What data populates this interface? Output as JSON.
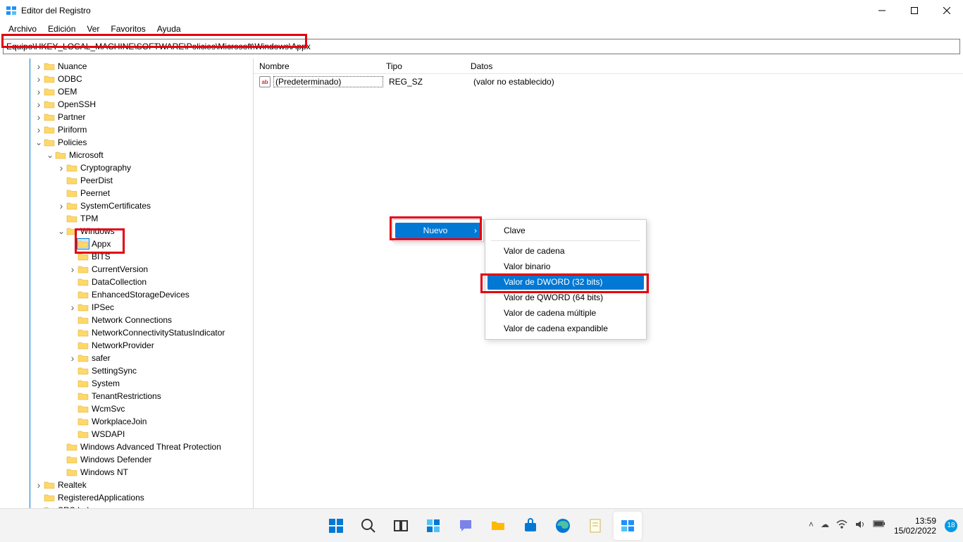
{
  "window": {
    "title": "Editor del Registro"
  },
  "menus": [
    "Archivo",
    "Edición",
    "Ver",
    "Favoritos",
    "Ayuda"
  ],
  "address": "Equipo\\HKEY_LOCAL_MACHINE\\SOFTWARE\\Policies\\Microsoft\\Windows\\Appx",
  "tree": {
    "top": [
      {
        "d": 3,
        "e": "closed",
        "l": "Nuance"
      },
      {
        "d": 3,
        "e": "closed",
        "l": "ODBC"
      },
      {
        "d": 3,
        "e": "closed",
        "l": "OEM"
      },
      {
        "d": 3,
        "e": "closed",
        "l": "OpenSSH"
      },
      {
        "d": 3,
        "e": "closed",
        "l": "Partner"
      },
      {
        "d": 3,
        "e": "closed",
        "l": "Piriform"
      },
      {
        "d": 3,
        "e": "open",
        "l": "Policies"
      },
      {
        "d": 4,
        "e": "open",
        "l": "Microsoft"
      },
      {
        "d": 5,
        "e": "closed",
        "l": "Cryptography"
      },
      {
        "d": 5,
        "e": "none",
        "l": "PeerDist"
      },
      {
        "d": 5,
        "e": "none",
        "l": "Peernet"
      },
      {
        "d": 5,
        "e": "closed",
        "l": "SystemCertificates"
      },
      {
        "d": 5,
        "e": "none",
        "l": "TPM"
      },
      {
        "d": 5,
        "e": "open",
        "l": "Windows"
      },
      {
        "d": 6,
        "e": "none",
        "l": "Appx",
        "sel": true
      },
      {
        "d": 6,
        "e": "none",
        "l": "BITS"
      },
      {
        "d": 6,
        "e": "closed",
        "l": "CurrentVersion"
      },
      {
        "d": 6,
        "e": "none",
        "l": "DataCollection"
      },
      {
        "d": 6,
        "e": "none",
        "l": "EnhancedStorageDevices"
      },
      {
        "d": 6,
        "e": "closed",
        "l": "IPSec"
      },
      {
        "d": 6,
        "e": "none",
        "l": "Network Connections"
      },
      {
        "d": 6,
        "e": "none",
        "l": "NetworkConnectivityStatusIndicator"
      },
      {
        "d": 6,
        "e": "none",
        "l": "NetworkProvider"
      },
      {
        "d": 6,
        "e": "closed",
        "l": "safer"
      },
      {
        "d": 6,
        "e": "none",
        "l": "SettingSync"
      },
      {
        "d": 6,
        "e": "none",
        "l": "System"
      },
      {
        "d": 6,
        "e": "none",
        "l": "TenantRestrictions"
      },
      {
        "d": 6,
        "e": "none",
        "l": "WcmSvc"
      },
      {
        "d": 6,
        "e": "none",
        "l": "WorkplaceJoin"
      },
      {
        "d": 6,
        "e": "none",
        "l": "WSDAPI"
      },
      {
        "d": 5,
        "e": "none",
        "l": "Windows Advanced Threat Protection"
      },
      {
        "d": 5,
        "e": "none",
        "l": "Windows Defender"
      },
      {
        "d": 5,
        "e": "none",
        "l": "Windows NT"
      },
      {
        "d": 3,
        "e": "closed",
        "l": "Realtek"
      },
      {
        "d": 3,
        "e": "none",
        "l": "RegisteredApplications"
      },
      {
        "d": 3,
        "e": "closed",
        "l": "SRS Labs"
      }
    ]
  },
  "list": {
    "cols": {
      "name": "Nombre",
      "type": "Tipo",
      "data": "Datos"
    },
    "rows": [
      {
        "icon": "ab",
        "name": "(Predeterminado)",
        "type": "REG_SZ",
        "data": "(valor no establecido)"
      }
    ]
  },
  "ctx1": {
    "new": "Nuevo"
  },
  "ctx2": {
    "key": "Clave",
    "string": "Valor de cadena",
    "binary": "Valor binario",
    "dword": "Valor de DWORD (32 bits)",
    "qword": "Valor de QWORD (64 bits)",
    "multi": "Valor de cadena múltiple",
    "expand": "Valor de cadena expandible"
  },
  "taskbar": {
    "time": "13:59",
    "date": "15/02/2022",
    "notif": "18"
  }
}
